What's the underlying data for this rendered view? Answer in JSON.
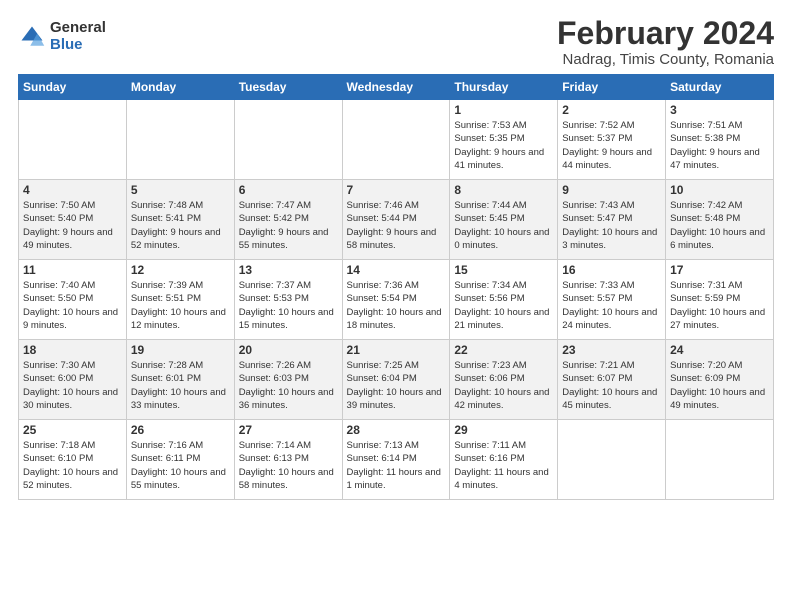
{
  "logo": {
    "general": "General",
    "blue": "Blue"
  },
  "title": "February 2024",
  "subtitle": "Nadrag, Timis County, Romania",
  "days_header": [
    "Sunday",
    "Monday",
    "Tuesday",
    "Wednesday",
    "Thursday",
    "Friday",
    "Saturday"
  ],
  "weeks": [
    [
      {
        "day": "",
        "info": ""
      },
      {
        "day": "",
        "info": ""
      },
      {
        "day": "",
        "info": ""
      },
      {
        "day": "",
        "info": ""
      },
      {
        "day": "1",
        "info": "Sunrise: 7:53 AM\nSunset: 5:35 PM\nDaylight: 9 hours and 41 minutes."
      },
      {
        "day": "2",
        "info": "Sunrise: 7:52 AM\nSunset: 5:37 PM\nDaylight: 9 hours and 44 minutes."
      },
      {
        "day": "3",
        "info": "Sunrise: 7:51 AM\nSunset: 5:38 PM\nDaylight: 9 hours and 47 minutes."
      }
    ],
    [
      {
        "day": "4",
        "info": "Sunrise: 7:50 AM\nSunset: 5:40 PM\nDaylight: 9 hours and 49 minutes."
      },
      {
        "day": "5",
        "info": "Sunrise: 7:48 AM\nSunset: 5:41 PM\nDaylight: 9 hours and 52 minutes."
      },
      {
        "day": "6",
        "info": "Sunrise: 7:47 AM\nSunset: 5:42 PM\nDaylight: 9 hours and 55 minutes."
      },
      {
        "day": "7",
        "info": "Sunrise: 7:46 AM\nSunset: 5:44 PM\nDaylight: 9 hours and 58 minutes."
      },
      {
        "day": "8",
        "info": "Sunrise: 7:44 AM\nSunset: 5:45 PM\nDaylight: 10 hours and 0 minutes."
      },
      {
        "day": "9",
        "info": "Sunrise: 7:43 AM\nSunset: 5:47 PM\nDaylight: 10 hours and 3 minutes."
      },
      {
        "day": "10",
        "info": "Sunrise: 7:42 AM\nSunset: 5:48 PM\nDaylight: 10 hours and 6 minutes."
      }
    ],
    [
      {
        "day": "11",
        "info": "Sunrise: 7:40 AM\nSunset: 5:50 PM\nDaylight: 10 hours and 9 minutes."
      },
      {
        "day": "12",
        "info": "Sunrise: 7:39 AM\nSunset: 5:51 PM\nDaylight: 10 hours and 12 minutes."
      },
      {
        "day": "13",
        "info": "Sunrise: 7:37 AM\nSunset: 5:53 PM\nDaylight: 10 hours and 15 minutes."
      },
      {
        "day": "14",
        "info": "Sunrise: 7:36 AM\nSunset: 5:54 PM\nDaylight: 10 hours and 18 minutes."
      },
      {
        "day": "15",
        "info": "Sunrise: 7:34 AM\nSunset: 5:56 PM\nDaylight: 10 hours and 21 minutes."
      },
      {
        "day": "16",
        "info": "Sunrise: 7:33 AM\nSunset: 5:57 PM\nDaylight: 10 hours and 24 minutes."
      },
      {
        "day": "17",
        "info": "Sunrise: 7:31 AM\nSunset: 5:59 PM\nDaylight: 10 hours and 27 minutes."
      }
    ],
    [
      {
        "day": "18",
        "info": "Sunrise: 7:30 AM\nSunset: 6:00 PM\nDaylight: 10 hours and 30 minutes."
      },
      {
        "day": "19",
        "info": "Sunrise: 7:28 AM\nSunset: 6:01 PM\nDaylight: 10 hours and 33 minutes."
      },
      {
        "day": "20",
        "info": "Sunrise: 7:26 AM\nSunset: 6:03 PM\nDaylight: 10 hours and 36 minutes."
      },
      {
        "day": "21",
        "info": "Sunrise: 7:25 AM\nSunset: 6:04 PM\nDaylight: 10 hours and 39 minutes."
      },
      {
        "day": "22",
        "info": "Sunrise: 7:23 AM\nSunset: 6:06 PM\nDaylight: 10 hours and 42 minutes."
      },
      {
        "day": "23",
        "info": "Sunrise: 7:21 AM\nSunset: 6:07 PM\nDaylight: 10 hours and 45 minutes."
      },
      {
        "day": "24",
        "info": "Sunrise: 7:20 AM\nSunset: 6:09 PM\nDaylight: 10 hours and 49 minutes."
      }
    ],
    [
      {
        "day": "25",
        "info": "Sunrise: 7:18 AM\nSunset: 6:10 PM\nDaylight: 10 hours and 52 minutes."
      },
      {
        "day": "26",
        "info": "Sunrise: 7:16 AM\nSunset: 6:11 PM\nDaylight: 10 hours and 55 minutes."
      },
      {
        "day": "27",
        "info": "Sunrise: 7:14 AM\nSunset: 6:13 PM\nDaylight: 10 hours and 58 minutes."
      },
      {
        "day": "28",
        "info": "Sunrise: 7:13 AM\nSunset: 6:14 PM\nDaylight: 11 hours and 1 minute."
      },
      {
        "day": "29",
        "info": "Sunrise: 7:11 AM\nSunset: 6:16 PM\nDaylight: 11 hours and 4 minutes."
      },
      {
        "day": "",
        "info": ""
      },
      {
        "day": "",
        "info": ""
      }
    ]
  ]
}
